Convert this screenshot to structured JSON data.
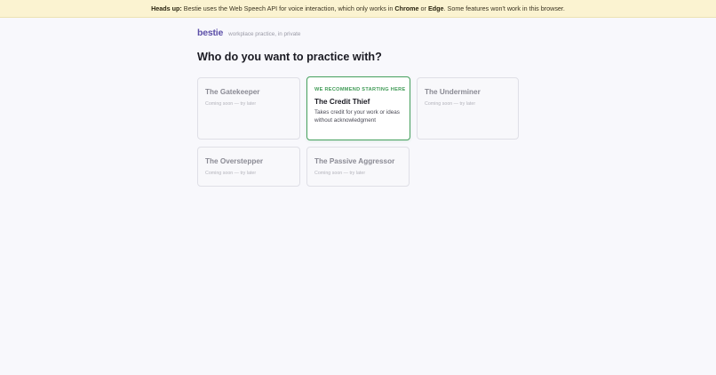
{
  "banner": {
    "label": "Heads up:",
    "text_before": " Bestie uses the Web Speech API for voice interaction, which only works in ",
    "browser_1": "Chrome",
    "joiner": " or ",
    "browser_2": "Edge",
    "text_after": ". Some features won't work in this browser."
  },
  "brand": {
    "logo": "bestie",
    "tagline": "workplace practice, in private",
    "color": "#5c4fa8"
  },
  "headline": "Who do you want to practice with?",
  "cards": [
    {
      "title": "The Gatekeeper",
      "subtitle": "Coming soon — try later",
      "available": false
    },
    {
      "badge": "WE RECOMMEND STARTING HERE",
      "title": "The Credit Thief",
      "description": "Takes credit for your work or ideas without acknowledgment",
      "available": true,
      "accent": "#46a05e"
    },
    {
      "title": "The Underminer",
      "subtitle": "Coming soon — try later",
      "available": false
    },
    {
      "title": "The Overstepper",
      "subtitle": "Coming soon — try later",
      "available": false
    },
    {
      "title": "The Passive Aggressor",
      "subtitle": "Coming soon — try later",
      "available": false
    }
  ]
}
